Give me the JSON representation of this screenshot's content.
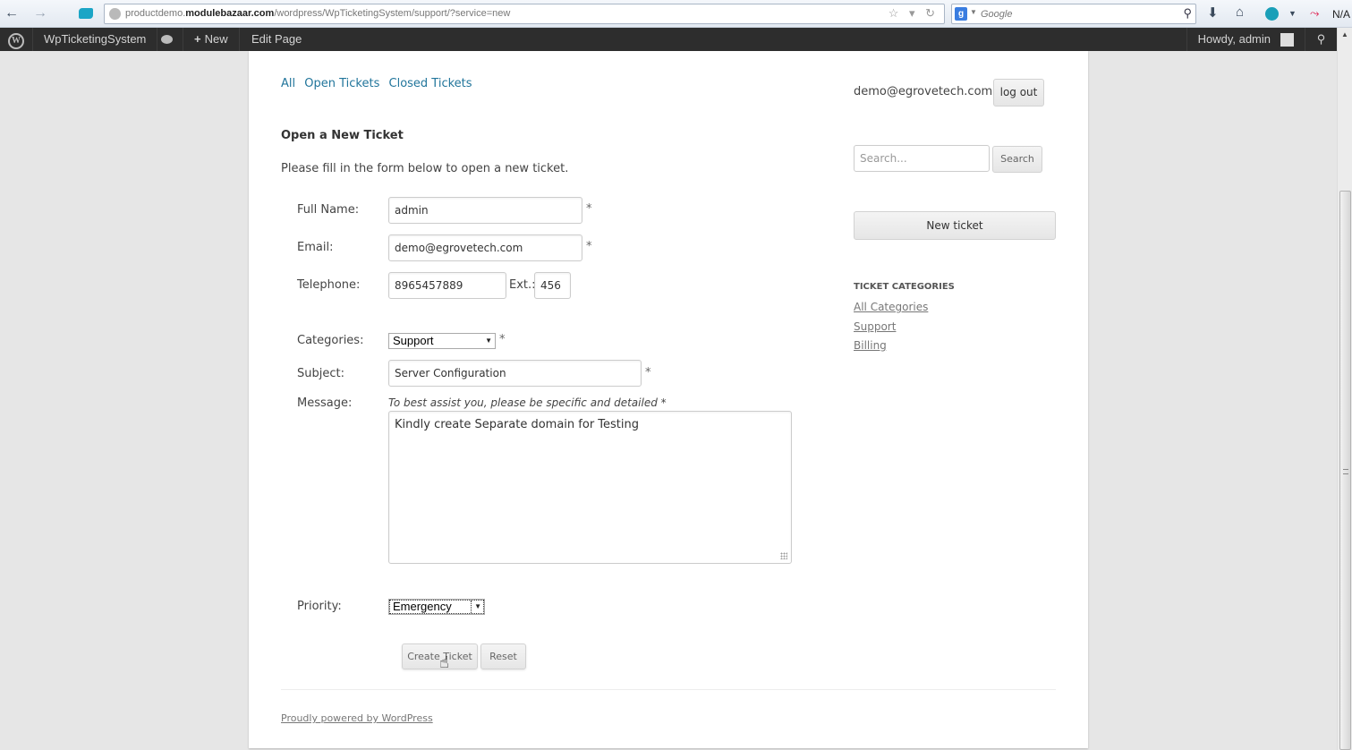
{
  "browser": {
    "url_prefix": "productdemo.",
    "url_domain": "modulebazaar.com",
    "url_path": "/wordpress/WpTicketingSystem/support/?service=new",
    "search_placeholder": "Google",
    "addon_status": "N/A",
    "icons": {
      "back": "←",
      "forward": "→",
      "bookmark_star": "☆ ▾ ↻",
      "search_mag": "⚲",
      "download": "⬇",
      "home": "⌂",
      "chart": "⤳",
      "g": "g"
    }
  },
  "adminbar": {
    "wp_logo": "W",
    "site_name": "WpTicketingSystem",
    "new_label": "New",
    "new_plus": "+",
    "edit_page": "Edit Page",
    "howdy": "Howdy, admin",
    "search_icon": "⚲"
  },
  "filters": [
    "All",
    "Open Tickets",
    "Closed Tickets"
  ],
  "form": {
    "title": "Open a New Ticket",
    "intro": "Please fill in the form below to open a new ticket.",
    "required_mark": "*",
    "full_name": {
      "label": "Full Name:",
      "value": "admin"
    },
    "email": {
      "label": "Email:",
      "value": "demo@egrovetech.com"
    },
    "telephone": {
      "label": "Telephone:",
      "value": "8965457889",
      "ext_label": "Ext.:",
      "ext_value": "456"
    },
    "categories": {
      "label": "Categories:",
      "selected": "Support"
    },
    "subject": {
      "label": "Subject:",
      "value": "Server Configuration"
    },
    "message": {
      "label": "Message:",
      "hint": "To best assist you, please be specific and detailed *",
      "value": "Kindly create Separate domain for Testing"
    },
    "priority": {
      "label": "Priority:",
      "selected": "Emergency"
    },
    "create_button": "Create Ticket",
    "reset_button": "Reset"
  },
  "sidebar": {
    "user_email": "demo@egrovetech.com |",
    "logout": "log out",
    "search_placeholder": "Search...",
    "search_button": "Search",
    "new_ticket": "New ticket",
    "categories_heading": "TICKET CATEGORIES",
    "categories": [
      "All Categories",
      "Support",
      "Billing"
    ]
  },
  "footer": {
    "powered_by": "Proudly powered by WordPress"
  }
}
